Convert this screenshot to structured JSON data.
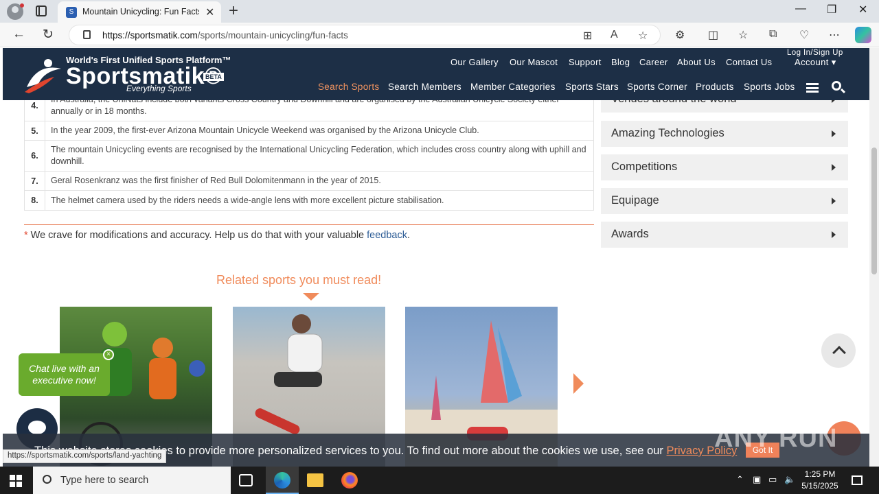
{
  "browser": {
    "tab_title": "Mountain Unicycling: Fun Facts,",
    "url_host": "https://sportsmatik.com",
    "url_path": "/sports/mountain-unicycling/fun-facts",
    "status_url": "https://sportsmatik.com/sports/land-yachting"
  },
  "header": {
    "tagline": "World's First Unified Sports Platform™",
    "brand": "Sportsmatik®",
    "beta": "BETA",
    "subtitle": "Everything Sports",
    "login": "Log In/Sign Up",
    "account": "Account ▾",
    "top_nav": [
      "Our Gallery",
      "Our Mascot",
      "Support",
      "Blog",
      "Career",
      "About Us",
      "Contact Us"
    ],
    "main_nav": [
      "Search Sports",
      "Search Members",
      "Member Categories",
      "Sports Stars",
      "Sports Corner",
      "Products",
      "Sports Jobs"
    ]
  },
  "facts": [
    {
      "num": "4.",
      "text": "In Australia, the UniNats include both variants Cross Country and Downhill and are organised by the Australian Unicycle Society either annually or in 18 months."
    },
    {
      "num": "5.",
      "text": "In the year 2009, the first-ever Arizona Mountain Unicycle Weekend was organised by the Arizona Unicycle Club."
    },
    {
      "num": "6.",
      "text": "The mountain Unicycling events are recognised by the International Unicycling Federation, which includes cross country along with uphill and downhill."
    },
    {
      "num": "7.",
      "text": "Geral Rosenkranz was the first finisher of Red Bull Dolomitenmann in the year of 2015."
    },
    {
      "num": "8.",
      "text": "The helmet camera used by the riders needs a wide-angle lens with more excellent picture stabilisation."
    }
  ],
  "feedback": {
    "star": "*",
    "text": "We crave for modifications and accuracy. Help us do that with your valuable",
    "link": "feedback",
    "end": "."
  },
  "sidebar": {
    "items": [
      "Venues around the world",
      "Amazing Technologies",
      "Competitions",
      "Equipage",
      "Awards"
    ]
  },
  "related": {
    "title": "Related sports you must read!"
  },
  "chat": {
    "bubble": "Chat live with an executive now!",
    "close": "×"
  },
  "cookie": {
    "text": "This website stores cookies to provide more personalized services to you. To find out more about the cookies we use, see our",
    "link": "Privacy Policy",
    "button": "Got It"
  },
  "watermark": "ANY RUN",
  "taskbar": {
    "search_placeholder": "Type here to search",
    "time": "1:25 PM",
    "date": "5/15/2025"
  }
}
